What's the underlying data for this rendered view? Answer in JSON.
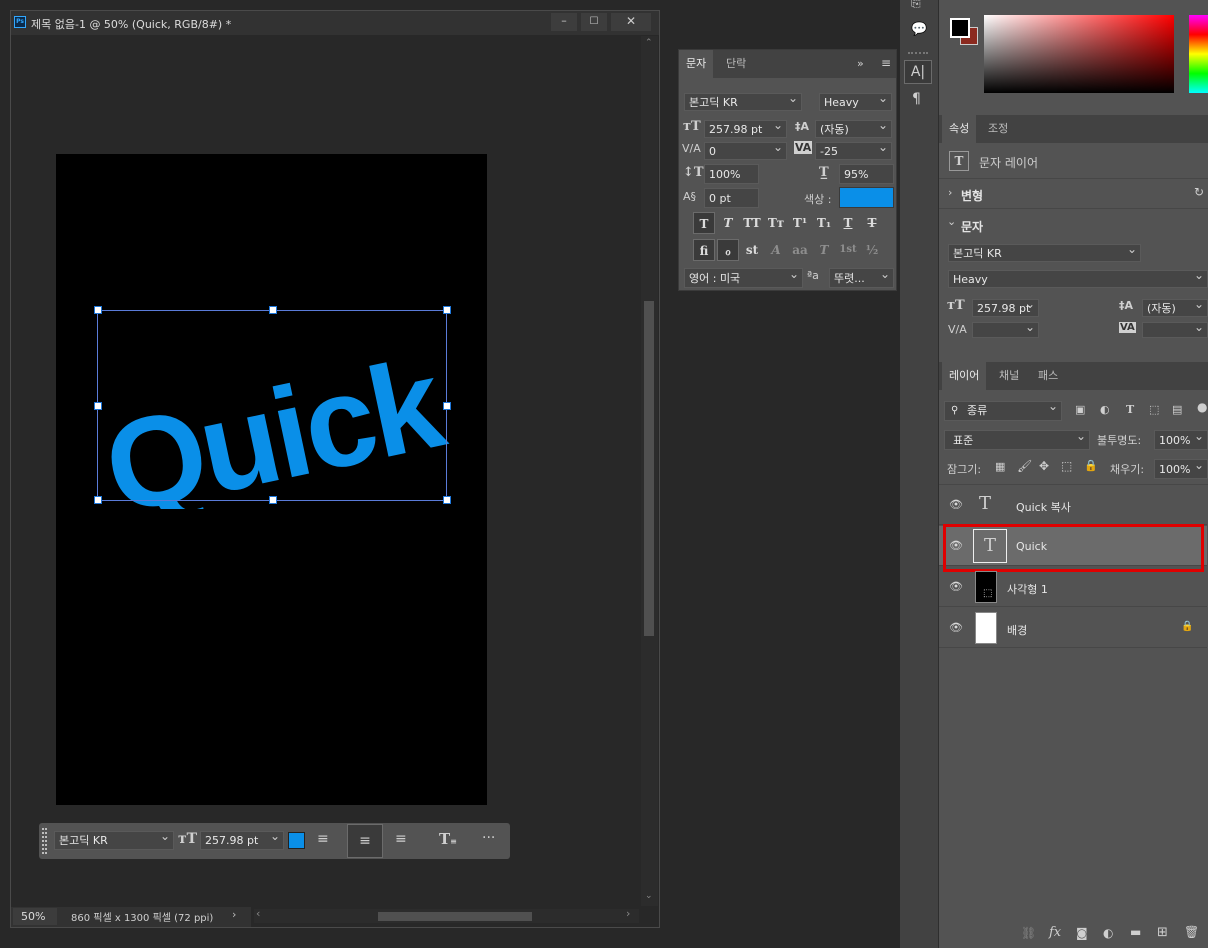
{
  "document": {
    "title": "제목 없음-1 @ 50% (Quick, RGB/8#) *",
    "app_badge": "Ps",
    "canvas_text": "Quick",
    "canvas_text_color": "#0a8fe8",
    "zoom": "50%",
    "dimensions": "860 픽셀 x 1300 픽셀 (72 ppi)"
  },
  "context_bar": {
    "font_family": "본고딕 KR",
    "font_size": "257.98 pt",
    "color": "#0a8fe8"
  },
  "character_panel": {
    "tabs": [
      "문자",
      "단락"
    ],
    "font_family": "본고딕 KR",
    "font_style": "Heavy",
    "font_size": "257.98 pt",
    "leading": "(자동)",
    "kerning": "0",
    "tracking": "-25",
    "vertical_scale": "100%",
    "horizontal_scale": "95%",
    "baseline_shift": "0 pt",
    "color_label": "색상 :",
    "color": "#0a8fe8",
    "language": "영어 : 미국",
    "antialias": "뚜렷...",
    "format_buttons": [
      "T",
      "T",
      "TT",
      "Tт",
      "T¹",
      "T₁",
      "T",
      "T"
    ],
    "opentype_buttons": [
      "fi",
      "ℴ",
      "st",
      "A",
      "aa",
      "T",
      "1st",
      "½"
    ]
  },
  "color_picker": {
    "foreground": "#000000",
    "background": "#8b2a1f"
  },
  "properties_panel": {
    "tabs": [
      "속성",
      "조정"
    ],
    "layer_type": "문자 레이어",
    "transform_label": "변형",
    "character_label": "문자",
    "font_family": "본고딕 KR",
    "font_style": "Heavy",
    "font_size": "257.98 pt",
    "leading": "(자동)"
  },
  "layers_panel": {
    "tabs": [
      "레이어",
      "채널",
      "패스"
    ],
    "filter": "종류",
    "blend_mode": "표준",
    "opacity_label": "불투명도:",
    "opacity": "100%",
    "lock_label": "잠그기:",
    "fill_label": "채우기:",
    "fill": "100%",
    "layers": [
      {
        "name": "Quick 복사",
        "kind": "text"
      },
      {
        "name": "Quick",
        "kind": "text",
        "selected": true
      },
      {
        "name": "사각형 1",
        "kind": "shape"
      },
      {
        "name": "배경",
        "kind": "background",
        "locked": true
      }
    ]
  }
}
